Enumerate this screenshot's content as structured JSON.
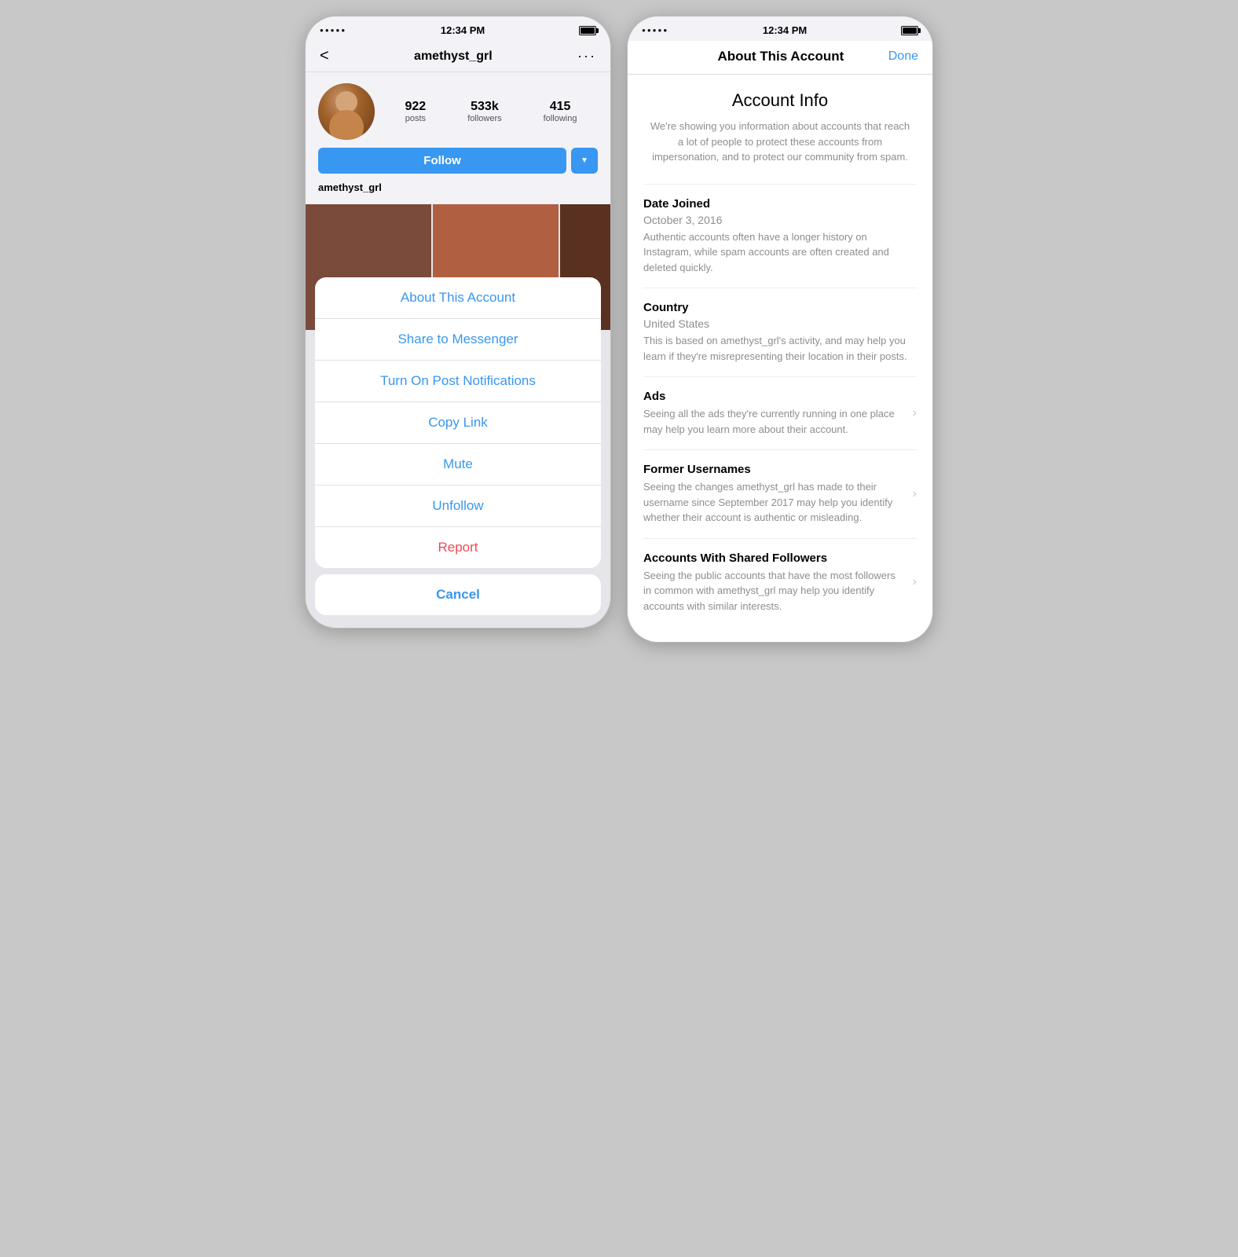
{
  "left_phone": {
    "status_bar": {
      "dots": "●●●●●",
      "time": "12:34 PM"
    },
    "nav": {
      "back_label": "<",
      "username": "amethyst_grl",
      "more_label": "···"
    },
    "profile": {
      "posts_count": "922",
      "posts_label": "posts",
      "followers_count": "533k",
      "followers_label": "followers",
      "following_count": "415",
      "following_label": "following",
      "follow_btn": "Follow",
      "username": "amethyst_grl"
    },
    "action_sheet": {
      "items": [
        {
          "label": "About This Account",
          "color": "blue"
        },
        {
          "label": "Share to Messenger",
          "color": "blue"
        },
        {
          "label": "Turn On Post Notifications",
          "color": "blue"
        },
        {
          "label": "Copy Link",
          "color": "blue"
        },
        {
          "label": "Mute",
          "color": "blue"
        },
        {
          "label": "Unfollow",
          "color": "blue"
        },
        {
          "label": "Report",
          "color": "red"
        }
      ],
      "cancel_label": "Cancel"
    }
  },
  "right_phone": {
    "status_bar": {
      "dots": "●●●●●",
      "time": "12:34 PM"
    },
    "nav": {
      "title": "About This Account",
      "done_label": "Done"
    },
    "account_info": {
      "title": "Account Info",
      "description": "We're showing you information about accounts that reach a lot of people to protect these accounts from impersonation, and to protect our community from spam.",
      "sections": [
        {
          "title": "Date Joined",
          "value": "October 3, 2016",
          "desc": "Authentic accounts often have a longer history on Instagram, while spam accounts are often created and deleted quickly.",
          "has_chevron": false
        },
        {
          "title": "Country",
          "value": "United States",
          "desc": "This is based on amethyst_grl's activity, and may help you learn if they're misrepresenting their location in their posts.",
          "has_chevron": false
        },
        {
          "title": "Ads",
          "value": "",
          "desc": "Seeing all the ads they're currently running in one place may help you learn more about their account.",
          "has_chevron": true
        },
        {
          "title": "Former Usernames",
          "value": "",
          "desc": "Seeing the changes amethyst_grl has made to their username since September 2017 may help you identify whether their account is authentic or misleading.",
          "has_chevron": true
        },
        {
          "title": "Accounts With Shared Followers",
          "value": "",
          "desc": "Seeing the public accounts that have the most followers in common with amethyst_grl may help you identify accounts with similar interests.",
          "has_chevron": true
        }
      ]
    }
  }
}
